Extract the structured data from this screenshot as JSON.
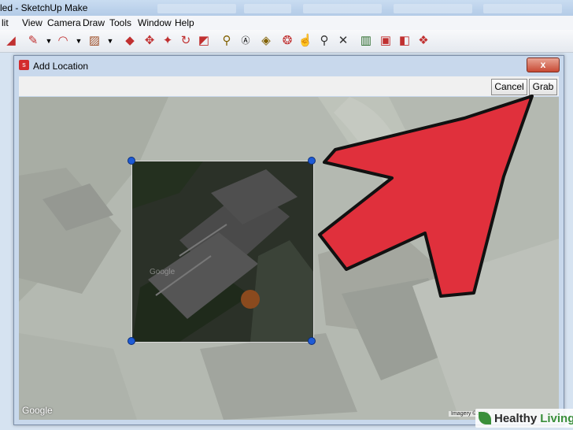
{
  "window": {
    "title": "led - SketchUp Make"
  },
  "menu": [
    "lit",
    "View",
    "Camera",
    "Draw",
    "Tools",
    "Window",
    "Help"
  ],
  "toolbar_icons": [
    "eraser-icon",
    "pencil-icon",
    "dropdown-icon",
    "arc-icon",
    "dropdown-icon",
    "rectangle-icon",
    "dropdown-icon",
    "push-pull-icon",
    "move-icon",
    "rotate-icon",
    "scale-icon",
    "tape-measure-icon",
    "text-icon",
    "paint-bucket-icon",
    "orbit-icon",
    "pan-icon",
    "zoom-icon",
    "zoom-extents-icon",
    "add-location-icon",
    "warehouse-icon",
    "share-model-icon",
    "extension-icon"
  ],
  "dialog": {
    "title": "Add Location",
    "close_label": "x",
    "cancel_label": "Cancel",
    "grab_label": "Grab"
  },
  "map": {
    "google_label": "Google",
    "imagery_label": "Imagery ©2015",
    "selection_watermark": "Google"
  },
  "watermark": {
    "brand": "Healthy",
    "sub": "Living"
  },
  "colors": {
    "arrow": "#e0303c",
    "handle": "#1e5bd6"
  }
}
